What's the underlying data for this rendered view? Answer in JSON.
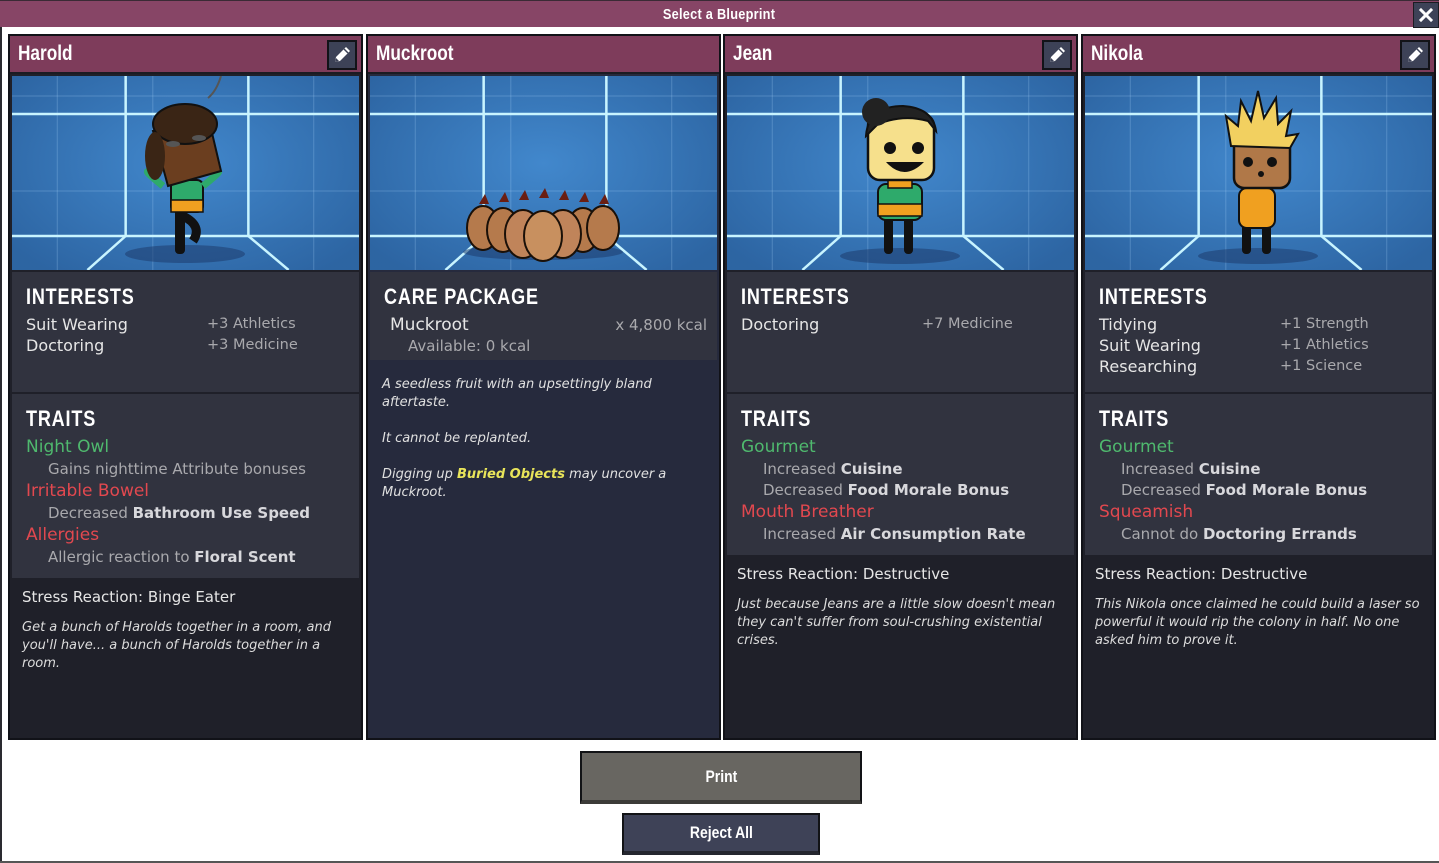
{
  "window": {
    "title": "Select a Blueprint",
    "close_icon": "close-icon"
  },
  "colors": {
    "header": "#7e3c5b",
    "titlebar": "#874566",
    "good_trait": "#4fb96e",
    "bad_trait": "#e2484f",
    "link": "#e8e45a",
    "panel": "#31333f"
  },
  "cards": [
    {
      "name": "Harold",
      "type": "duplicant",
      "edit_icon": "pencil-icon",
      "interests_title": "Interests",
      "interests": [
        {
          "name": "Suit Wearing",
          "bonus": "+3 Athletics"
        },
        {
          "name": "Doctoring",
          "bonus": "+3 Medicine"
        }
      ],
      "traits_title": "Traits",
      "traits": [
        {
          "name": "Night Owl",
          "kind": "good",
          "effects": [
            {
              "prefix": "Gains nighttime Attribute bonuses",
              "bold": ""
            }
          ]
        },
        {
          "name": "Irritable Bowel",
          "kind": "bad",
          "effects": [
            {
              "prefix": "Decreased ",
              "bold": "Bathroom Use Speed"
            }
          ]
        },
        {
          "name": "Allergies",
          "kind": "bad",
          "effects": [
            {
              "prefix": "Allergic reaction to ",
              "bold": "Floral Scent"
            }
          ]
        }
      ],
      "stress_reaction": "Stress Reaction: Binge Eater",
      "bio": "Get a bunch of Harolds together in a room, and you'll have... a bunch of Harolds together in a room."
    },
    {
      "name": "Muckroot",
      "type": "care_package",
      "package_title": "Care Package",
      "item": "Muckroot",
      "amount": "x 4,800 kcal",
      "available": "Available: 0 kcal",
      "description": [
        {
          "text": "A seedless fruit with an upsettingly bland aftertaste."
        },
        {
          "text": "It cannot be replanted."
        },
        {
          "before": "Digging up ",
          "link": "Buried Objects",
          "after": " may uncover a Muckroot."
        }
      ]
    },
    {
      "name": "Jean",
      "type": "duplicant",
      "edit_icon": "pencil-icon",
      "interests_title": "Interests",
      "interests": [
        {
          "name": "Doctoring",
          "bonus": "+7 Medicine"
        }
      ],
      "traits_title": "Traits",
      "traits": [
        {
          "name": "Gourmet",
          "kind": "good",
          "effects": [
            {
              "prefix": "Increased ",
              "bold": "Cuisine"
            },
            {
              "prefix": "Decreased ",
              "bold": "Food Morale Bonus"
            }
          ]
        },
        {
          "name": "Mouth Breather",
          "kind": "bad",
          "effects": [
            {
              "prefix": "Increased ",
              "bold": "Air Consumption Rate"
            }
          ]
        }
      ],
      "stress_reaction": "Stress Reaction: Destructive",
      "bio": "Just because Jeans are a little slow doesn't mean they can't suffer from soul-crushing existential crises."
    },
    {
      "name": "Nikola",
      "type": "duplicant",
      "edit_icon": "pencil-icon",
      "interests_title": "Interests",
      "interests": [
        {
          "name": "Tidying",
          "bonus": "+1 Strength"
        },
        {
          "name": "Suit Wearing",
          "bonus": "+1 Athletics"
        },
        {
          "name": "Researching",
          "bonus": "+1 Science"
        }
      ],
      "traits_title": "Traits",
      "traits": [
        {
          "name": "Gourmet",
          "kind": "good",
          "effects": [
            {
              "prefix": "Increased ",
              "bold": "Cuisine"
            },
            {
              "prefix": "Decreased ",
              "bold": "Food Morale Bonus"
            }
          ]
        },
        {
          "name": "Squeamish",
          "kind": "bad",
          "effects": [
            {
              "prefix": "Cannot do ",
              "bold": "Doctoring Errands"
            }
          ]
        }
      ],
      "stress_reaction": "Stress Reaction: Destructive",
      "bio": "This Nikola once claimed he could build a laser so powerful it would rip the colony in half. No one asked him to prove it."
    }
  ],
  "actions": {
    "print_label": "Print",
    "reject_all_label": "Reject All"
  }
}
